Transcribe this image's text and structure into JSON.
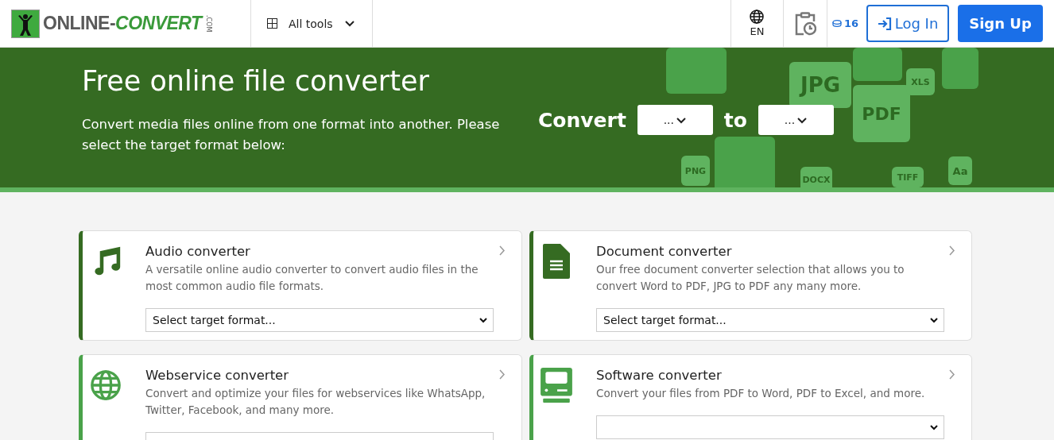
{
  "header": {
    "logo": {
      "word": "ONLINE-",
      "accent": "CONVERT",
      "suffix": ".COM"
    },
    "tools_menu": {
      "label": "All tools",
      "expanded": false
    },
    "language": "EN",
    "credits": "16",
    "login": "Log In",
    "signup": "Sign Up"
  },
  "hero": {
    "title": "Free online file converter",
    "subtitle": "Convert media files online from one format into another. Please select the target format below:",
    "convert_label": "Convert",
    "from_value": "...",
    "to_label": "to",
    "to_value": "...",
    "decor": [
      {
        "label": "JPG"
      },
      {
        "label": "PDF"
      },
      {
        "label": "PNG"
      },
      {
        "label": "XLS"
      },
      {
        "label": "DOCX"
      },
      {
        "label": "TIFF"
      },
      {
        "label": "Aa"
      }
    ]
  },
  "cards": [
    {
      "kind": "audio",
      "color": "#356b22",
      "title": "Audio converter",
      "description": "A versatile online audio converter to convert audio files in the most common audio file formats.",
      "select_value": "Select target format..."
    },
    {
      "kind": "document",
      "color": "#356b22",
      "title": "Document converter",
      "description": "Our free document converter selection that allows you to convert Word to PDF, JPG to PDF any many more.",
      "select_value": "Select target format..."
    },
    {
      "kind": "webservice",
      "color": "#4aa24a",
      "title": "Webservice converter",
      "description": "Convert and optimize your files for webservices like WhatsApp, Twitter, Facebook, and many more."
    },
    {
      "kind": "software",
      "color": "#4aa24a",
      "title": "Software converter",
      "description": "Convert your files from PDF to Word, PDF to Excel, and more."
    }
  ]
}
